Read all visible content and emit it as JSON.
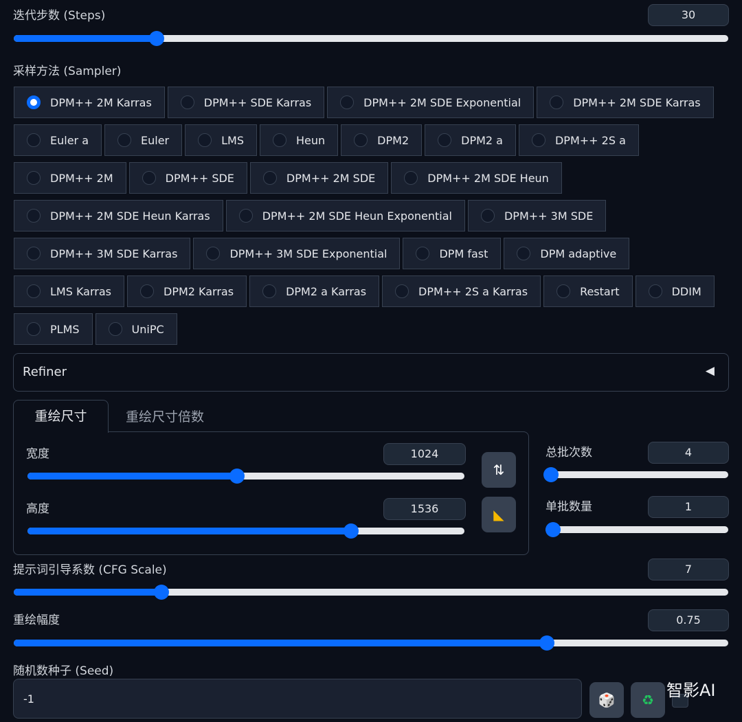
{
  "steps": {
    "label": "迭代步数 (Steps)",
    "value": "30",
    "fraction": 0.2
  },
  "sampler": {
    "label": "采样方法 (Sampler)",
    "selected": "DPM++ 2M Karras",
    "rows": [
      [
        "DPM++ 2M Karras",
        "DPM++ SDE Karras",
        "DPM++ 2M SDE Exponential",
        "DPM++ 2M SDE Karras"
      ],
      [
        "Euler a",
        "Euler",
        "LMS",
        "Heun",
        "DPM2",
        "DPM2 a",
        "DPM++ 2S a"
      ],
      [
        "DPM++ 2M",
        "DPM++ SDE",
        "DPM++ 2M SDE",
        "DPM++ 2M SDE Heun"
      ],
      [
        "DPM++ 2M SDE Heun Karras",
        "DPM++ 2M SDE Heun Exponential",
        "DPM++ 3M SDE"
      ],
      [
        "DPM++ 3M SDE Karras",
        "DPM++ 3M SDE Exponential",
        "DPM fast",
        "DPM adaptive"
      ],
      [
        "LMS Karras",
        "DPM2 Karras",
        "DPM2 a Karras",
        "DPM++ 2S a Karras",
        "Restart",
        "DDIM"
      ],
      [
        "PLMS",
        "UniPC"
      ]
    ]
  },
  "refiner": {
    "label": "Refiner",
    "icon": "◀"
  },
  "tabs": [
    "重绘尺寸",
    "重绘尺寸倍数"
  ],
  "width": {
    "label": "宽度",
    "value": "1024",
    "fraction": 0.48
  },
  "height": {
    "label": "高度",
    "value": "1536",
    "fraction": 0.74
  },
  "batch_count": {
    "label": "总批次数",
    "value": "4",
    "fraction": 0.03
  },
  "batch_size": {
    "label": "单批数量",
    "value": "1",
    "fraction": 0.0
  },
  "cfg": {
    "label": "提示词引导系数 (CFG Scale)",
    "value": "7",
    "fraction": 0.207
  },
  "denoise": {
    "label": "重绘幅度",
    "value": "0.75",
    "fraction": 0.746
  },
  "seed": {
    "label": "随机数种子 (Seed)",
    "value": "-1"
  },
  "icons": {
    "swap": "⇅",
    "ratio": "◣",
    "dice": "🎲",
    "recycle": "♻"
  },
  "watermark": "智影AI",
  "colors": {
    "accent": "#0a6cff",
    "background": "#0b0f19"
  }
}
